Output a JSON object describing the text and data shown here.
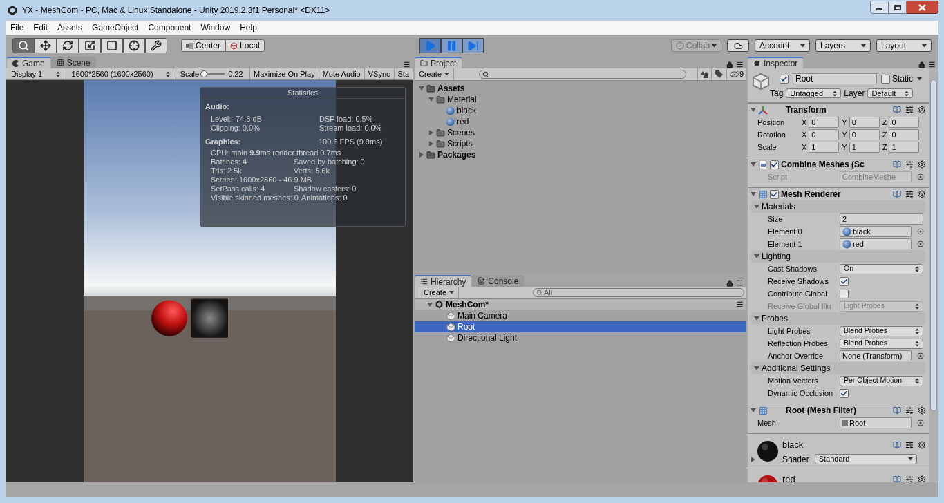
{
  "window": {
    "title": "YX - MeshCom - PC, Mac & Linux Standalone - Unity 2019.2.3f1 Personal* <DX11>"
  },
  "menu": [
    "File",
    "Edit",
    "Assets",
    "GameObject",
    "Component",
    "Window",
    "Help"
  ],
  "toolbar": {
    "tools": [
      {
        "kind": "view",
        "selected": true
      },
      {
        "kind": "move",
        "selected": false
      },
      {
        "kind": "rotate",
        "selected": false
      },
      {
        "kind": "scale",
        "selected": false
      },
      {
        "kind": "rect",
        "selected": false
      },
      {
        "kind": "transform",
        "selected": false
      },
      {
        "kind": "custom",
        "selected": false
      }
    ],
    "pivot": [
      {
        "kind": "center",
        "label": "Center"
      },
      {
        "kind": "local",
        "label": "Local"
      }
    ],
    "play": [
      {
        "kind": "play",
        "selected": true
      },
      {
        "kind": "pause",
        "selected": false
      },
      {
        "kind": "step",
        "selected": false
      }
    ],
    "collab": {
      "label": "Collab",
      "disabled": true
    },
    "menus": [
      "Account",
      "Layers",
      "Layout"
    ]
  },
  "game": {
    "tabs": [
      {
        "kind": "game",
        "label": "Game",
        "selected": true
      },
      {
        "kind": "scene",
        "label": "Scene",
        "selected": false
      }
    ],
    "bar": [
      {
        "kind": "dropdown",
        "label": "Display 1"
      },
      {
        "kind": "dropdown",
        "label": "1600*2560 (1600x2560)"
      },
      {
        "kind": "slider",
        "label": "Scale",
        "level": 0.05,
        "value": "0.22"
      },
      {
        "kind": "toggle",
        "label": "Maximize On Play"
      },
      {
        "kind": "toggle",
        "label": "Mute Audio"
      },
      {
        "kind": "toggle",
        "label": "VSync"
      },
      {
        "kind": "toggle",
        "label": "Sta"
      }
    ],
    "statistics": {
      "title": "Statistics",
      "sections": [
        {
          "kind": "audio",
          "heading": "Audio:",
          "rows": [
            [
              "Level: -74.8 dB",
              "DSP load: 0.5%"
            ],
            [
              "Clipping: 0.0%",
              "Stream load: 0.0%"
            ]
          ]
        },
        {
          "kind": "graphics",
          "heading": "Graphics:",
          "aside": "100.6 FPS (9.9ms)",
          "rows": [
            [
              "CPU: main **9.9**ms  render thread 0.7ms"
            ],
            [
              "Batches: **4**",
              "Saved by batching: 0"
            ],
            [
              "Tris: 2.5k",
              "Verts: 5.6k"
            ],
            [
              "Screen: 1600x2560 - 46.9 MB"
            ],
            [
              "SetPass calls: 4",
              "Shadow casters: 0"
            ],
            [
              "Visible skinned meshes: 0",
              "Animations: 0"
            ]
          ]
        }
      ]
    }
  },
  "project": {
    "tab": "Project",
    "create": "Create",
    "filter_count": "9",
    "tree": [
      {
        "kind": "root",
        "label": "Assets",
        "expanded": true,
        "children": [
          {
            "kind": "folder",
            "label": "Meterial",
            "expanded": true,
            "children": [
              {
                "kind": "material",
                "label": "black"
              },
              {
                "kind": "material",
                "label": "red"
              }
            ]
          },
          {
            "kind": "folder",
            "label": "Scenes",
            "expanded": false
          },
          {
            "kind": "folder",
            "label": "Scripts",
            "expanded": false
          }
        ]
      },
      {
        "kind": "root",
        "label": "Packages",
        "expanded": false
      }
    ]
  },
  "hierarchy": {
    "tabs": [
      {
        "kind": "hierarchy",
        "label": "Hierarchy",
        "selected": true
      },
      {
        "kind": "console",
        "label": "Console",
        "selected": false
      }
    ],
    "create": "Create",
    "search_placeholder": "All",
    "scene": {
      "label": "MeshCom*",
      "expanded": true
    },
    "items": [
      {
        "label": "Main Camera",
        "selected": false
      },
      {
        "label": "Root",
        "selected": true
      },
      {
        "label": "Directional Light",
        "selected": false
      }
    ]
  },
  "inspector": {
    "tab": "Inspector",
    "object": {
      "active": true,
      "name": "Root",
      "static": false,
      "static_label": "Static",
      "tag_label": "Tag",
      "tag": "Untagged",
      "layer_label": "Layer",
      "layer": "Default"
    },
    "components": [
      {
        "kind": "transform",
        "title": "Transform",
        "expanded": true,
        "rows": [
          {
            "label": "Position",
            "axes": [
              [
                "X",
                "0"
              ],
              [
                "Y",
                "0"
              ],
              [
                "Z",
                "0"
              ]
            ]
          },
          {
            "label": "Rotation",
            "axes": [
              [
                "X",
                "0"
              ],
              [
                "Y",
                "0"
              ],
              [
                "Z",
                "0"
              ]
            ]
          },
          {
            "label": "Scale",
            "axes": [
              [
                "X",
                "1"
              ],
              [
                "Y",
                "1"
              ],
              [
                "Z",
                "1"
              ]
            ]
          }
        ]
      },
      {
        "kind": "script",
        "title": "Combine Meshes (Sc",
        "expanded": true,
        "enabled": true,
        "rows": [
          {
            "kind": "object",
            "label": "Script",
            "value": "CombineMeshe",
            "disabled": true
          }
        ]
      },
      {
        "kind": "mesh_renderer",
        "title": "Mesh Renderer",
        "expanded": true,
        "enabled": true,
        "sections": [
          {
            "title": "Materials",
            "expanded": true,
            "rows": [
              {
                "kind": "field",
                "label": "Size",
                "value": "2",
                "disabled": false
              },
              {
                "kind": "object",
                "label": "Element 0",
                "value": "black",
                "disabled": false
              },
              {
                "kind": "object",
                "label": "Element 1",
                "value": "red",
                "disabled": false
              }
            ]
          },
          {
            "title": "Lighting",
            "expanded": true,
            "rows": [
              {
                "kind": "dropdown",
                "label": "Cast Shadows",
                "value": "On",
                "disabled": false
              },
              {
                "kind": "checkbox",
                "label": "Receive Shadows",
                "checked": true,
                "disabled": false
              },
              {
                "kind": "checkbox",
                "label": "Contribute Global",
                "checked": false,
                "disabled": false
              },
              {
                "kind": "dropdown",
                "label": "Receive Global Illu",
                "value": "Light Probes",
                "disabled": true
              }
            ]
          },
          {
            "title": "Probes",
            "expanded": true,
            "rows": [
              {
                "kind": "dropdown",
                "label": "Light Probes",
                "value": "Blend Probes",
                "disabled": false
              },
              {
                "kind": "dropdown",
                "label": "Reflection Probes",
                "value": "Blend Probes",
                "disabled": false
              },
              {
                "kind": "object",
                "label": "Anchor Override",
                "value": "None (Transform)",
                "disabled": false
              }
            ]
          },
          {
            "title": "Additional Settings",
            "expanded": true,
            "rows": [
              {
                "kind": "dropdown",
                "label": "Motion Vectors",
                "value": "Per Object Motion",
                "disabled": false
              },
              {
                "kind": "checkbox",
                "label": "Dynamic Occlusion",
                "checked": true,
                "disabled": false
              }
            ]
          }
        ]
      },
      {
        "kind": "mesh_filter",
        "title": "Root (Mesh Filter)",
        "expanded": true,
        "rows": [
          {
            "kind": "object",
            "label": "Mesh",
            "value": "Root",
            "disabled": false
          }
        ]
      }
    ],
    "materials": [
      {
        "name": "black",
        "color": "#111111",
        "expanded": false,
        "shader_label": "Shader",
        "shader": "Standard"
      },
      {
        "name": "red",
        "color": "#b01010"
      }
    ]
  }
}
